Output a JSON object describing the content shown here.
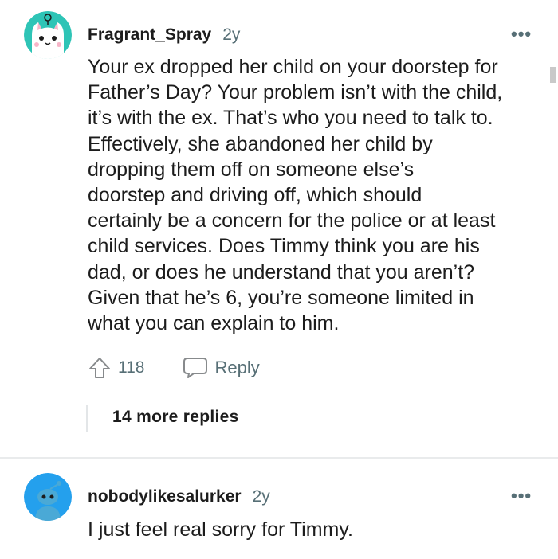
{
  "comments": [
    {
      "username": "Fragrant_Spray",
      "age": "2y",
      "more_icon": "•••",
      "avatar_icon": "cat-avatar-icon",
      "body": "Your ex dropped her child on your doorstep for\nFather’s Day? Your problem isn’t with the child,\nit’s with the ex. That’s who you need to talk to.\nEffectively, she abandoned her child by\ndropping them off on someone else’s\ndoorstep and driving off, which should\ncertainly be a concern for the police or at least\nchild services. Does Timmy think you are his\ndad, or does he understand that you aren’t?\nGiven that he’s 6, you’re someone limited in\nwhat you can explain to him.",
      "upvotes": "118",
      "reply_label": "Reply",
      "more_replies": "14 more replies"
    },
    {
      "username": "nobodylikesalurker",
      "age": "2y",
      "more_icon": "•••",
      "avatar_icon": "snoo-avatar-icon",
      "body": "I just feel real sorry for Timmy."
    }
  ],
  "colors": {
    "avatar_teal": "#2ec4b6",
    "avatar_blue": "#24a0ed",
    "meta_gray": "#576f76"
  }
}
